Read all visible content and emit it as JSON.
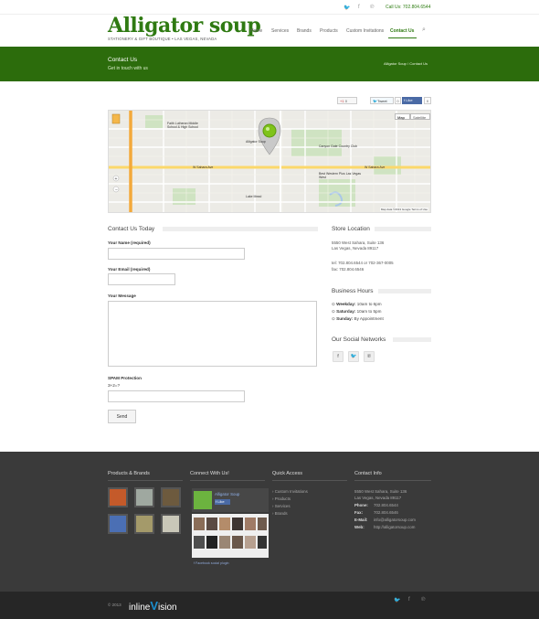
{
  "topbar": {
    "social_icons": [
      "twitter-icon",
      "facebook-icon",
      "pinterest-icon"
    ],
    "social_glyphs": [
      "🐦",
      "f",
      "℗"
    ],
    "call_us": "Call Us: 702.804.6544"
  },
  "header": {
    "logo": "Alligator soup",
    "tagline": "STATIONERY & GIFT BOUTIQUE • LAS VEGAS, NEVADA",
    "nav": [
      "Home",
      "Services",
      "Brands",
      "Products",
      "Custom Invitations",
      "Contact Us"
    ],
    "active_nav": "Contact Us",
    "search_glyph": "⌕"
  },
  "banner": {
    "title": "Contact Us",
    "subtitle": "Get in touch with us",
    "breadcrumb": "Alligator Soup / Contact Us"
  },
  "share": {
    "gplus": "+1",
    "gplus_count": "0",
    "tweet": "Tweet",
    "tweet_count": "0",
    "like": "Like",
    "like_count": "0"
  },
  "map": {
    "tab_map": "Map",
    "tab_satellite": "Satellite",
    "credit": "Map data ©2013 Google",
    "terms": "Terms of Use",
    "labels": {
      "saheara_ave_w": "W Sahara Ave",
      "sahara_ave_e": "W Sahara Ave",
      "charleston": "W Charleston Blvd",
      "desert_inn": "W Desert Inn Rd",
      "canyon_gate": "Canyon Gate Country Club",
      "sahara_west": "Alligator Soup",
      "school": "Faith Lutheran Middle School & High School",
      "lake_mead": "Lake Mead",
      "best_western": "Best Western Plus Las Vegas West"
    }
  },
  "contact_form": {
    "heading": "Contact Us Today",
    "name_label": "Your Name (required)",
    "email_label": "Your Email (required)",
    "message_label": "Your Message",
    "spam_label": "SPAM Protection",
    "spam_question": "3+2=?",
    "send_label": "Send"
  },
  "store_location": {
    "heading": "Store Location",
    "address_line1": "5550 West Sahara, Suite 136",
    "address_line2": "Las Vegas, Nevada 89117",
    "tel": "tel: 702.804.6544 or 702-367-0005",
    "fax": "fax: 702.804.6546"
  },
  "business_hours": {
    "heading": "Business Hours",
    "rows": [
      {
        "day": "Weekday:",
        "hours": "10am to 6pm"
      },
      {
        "day": "Saturday:",
        "hours": "10am to 5pm"
      },
      {
        "day": "Sunday:",
        "hours": "By Appointment"
      }
    ]
  },
  "social_networks": {
    "heading": "Our Social Networks",
    "buttons": [
      "f",
      "🐦",
      "℗"
    ]
  },
  "footer": {
    "products_heading": "Products & Brands",
    "connect_heading": "Connect With Us!",
    "quick_heading": "Quick Access",
    "contact_heading": "Contact Info",
    "fb_page_name": "Alligator Soup",
    "fb_like": "Like",
    "fb_plugin": "Facebook social plugin",
    "quick_links": [
      "Custom Invitations",
      "Products",
      "Services",
      "Brands"
    ],
    "contact": {
      "address1": "5550 West Sahara, Suite 136",
      "address2": "Las Vegas, Nevada 89117",
      "phone_label": "Phone:",
      "phone": "702.804.6544",
      "fax_label": "Fax:",
      "fax": "702.804.6546",
      "email_label": "E-Mail:",
      "email": "info@alligatorsoup.com",
      "web_label": "Web:",
      "web": "http://alligatorsoup.com"
    },
    "copyright": "© 2013",
    "vendor_prefix": "inline",
    "vendor_v": "V",
    "vendor_suffix": "ision",
    "bottom_social": [
      "🐦",
      "f",
      "℗"
    ]
  },
  "colors": {
    "brand_green": "#2c6c0c",
    "footer_bg": "#3a3a3a"
  }
}
